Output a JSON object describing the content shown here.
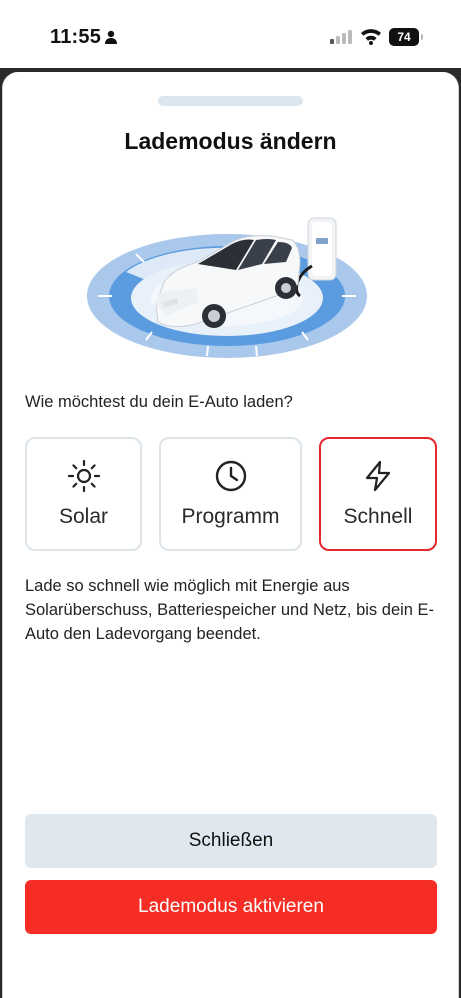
{
  "status_bar": {
    "time": "11:55",
    "battery": "74"
  },
  "sheet": {
    "title": "Lademodus ändern",
    "question": "Wie möchtest du dein E-Auto laden?",
    "modes": [
      {
        "label": "Solar",
        "icon": "sun-icon",
        "selected": false
      },
      {
        "label": "Programm",
        "icon": "clock-icon",
        "selected": false
      },
      {
        "label": "Schnell",
        "icon": "lightning-icon",
        "selected": true
      }
    ],
    "description": "Lade so schnell wie möglich mit Energie aus Solarüberschuss, Batteriespeicher und Netz, bis dein E-Auto den Ladevorgang beendet.",
    "close_label": "Schließen",
    "activate_label": "Lademodus aktivieren"
  },
  "colors": {
    "accent_red": "#f52d24",
    "selected_border": "#e8262d",
    "secondary_button": "#dfe8ee"
  }
}
